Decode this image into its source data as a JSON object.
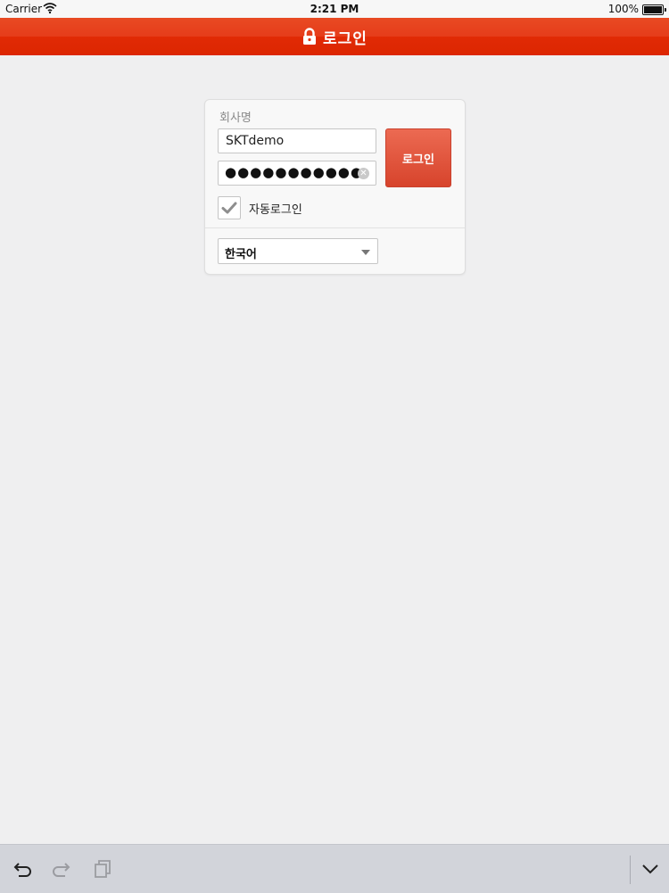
{
  "status_bar": {
    "carrier": "Carrier",
    "time": "2:21 PM",
    "battery": "100%"
  },
  "header": {
    "title": "로그인",
    "icon": "lock-icon",
    "color": "#e2330f"
  },
  "login_form": {
    "company_label": "회사명",
    "company_value": "SKTdemo",
    "password_value": "●●●●●●●●●●●",
    "login_button": "로그인",
    "auto_login_label": "자동로그인",
    "auto_login_checked": true,
    "language_value": "한국어"
  },
  "keyboard_toolbar": {
    "icons": [
      "undo-icon",
      "redo-icon",
      "paste-icon",
      "hide-keyboard-icon"
    ]
  }
}
